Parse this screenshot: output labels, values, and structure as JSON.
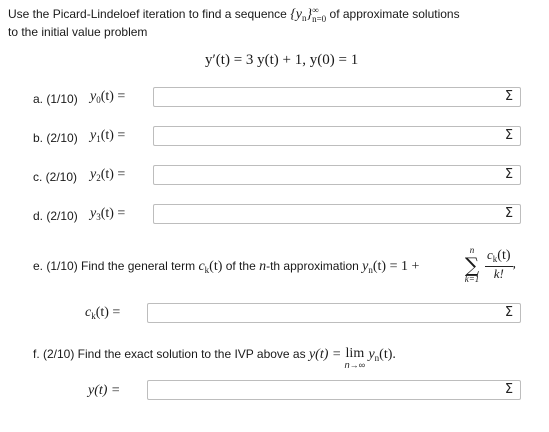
{
  "intro": {
    "line1_pre": "Use the Picard-Lindeloef iteration to find a sequence",
    "line1_seq": "{y",
    "line1_seq_sub": "n",
    "line1_seq_close": "}",
    "line1_sup": "∞",
    "line1_sub": "n=0",
    "line1_post": "of approximate solutions",
    "line2": "to the initial value problem"
  },
  "ode": "y′(t) = 3 y(t) + 1,   y(0) = 1",
  "parts": [
    {
      "label": "a. (1/10)",
      "lhs_var": "y",
      "lhs_sub": "0",
      "lhs_rest": "(t) =",
      "value": ""
    },
    {
      "label": "b. (2/10)",
      "lhs_var": "y",
      "lhs_sub": "1",
      "lhs_rest": "(t) =",
      "value": ""
    },
    {
      "label": "c. (2/10)",
      "lhs_var": "y",
      "lhs_sub": "2",
      "lhs_rest": "(t) =",
      "value": ""
    },
    {
      "label": "d. (2/10)",
      "lhs_var": "y",
      "lhs_sub": "3",
      "lhs_rest": "(t) =",
      "value": ""
    }
  ],
  "part_e": {
    "text_pre": "e. (1/10) Find the general term",
    "ck": "c",
    "ck_sub": "k",
    "ck_t": "(t)",
    "text_mid": "of the",
    "n": "n",
    "text_mid2": "-th approximation",
    "yn": "y",
    "yn_sub": "n",
    "yn_rest": "(t) = 1 +",
    "sum_top": "n",
    "sum_symbol": "∑",
    "sum_bottom": "k=1",
    "frac_num": "c",
    "frac_num_sub": "k",
    "frac_num_rest": "(t)",
    "frac_den": "k!",
    "trail": ",",
    "answer_lhs": "c",
    "answer_lhs_sub": "k",
    "answer_lhs_rest": "(t) =",
    "value": ""
  },
  "part_f": {
    "text_pre": "f. (2/10) Find the exact solution to the IVP above as",
    "y": "y(t) =",
    "lim": "lim",
    "lim_under": "n→∞",
    "yn": "y",
    "yn_sub": "n",
    "yn_rest": "(t).",
    "answer_lhs": "y(t) =",
    "value": ""
  },
  "sigma_icon": "Σ"
}
